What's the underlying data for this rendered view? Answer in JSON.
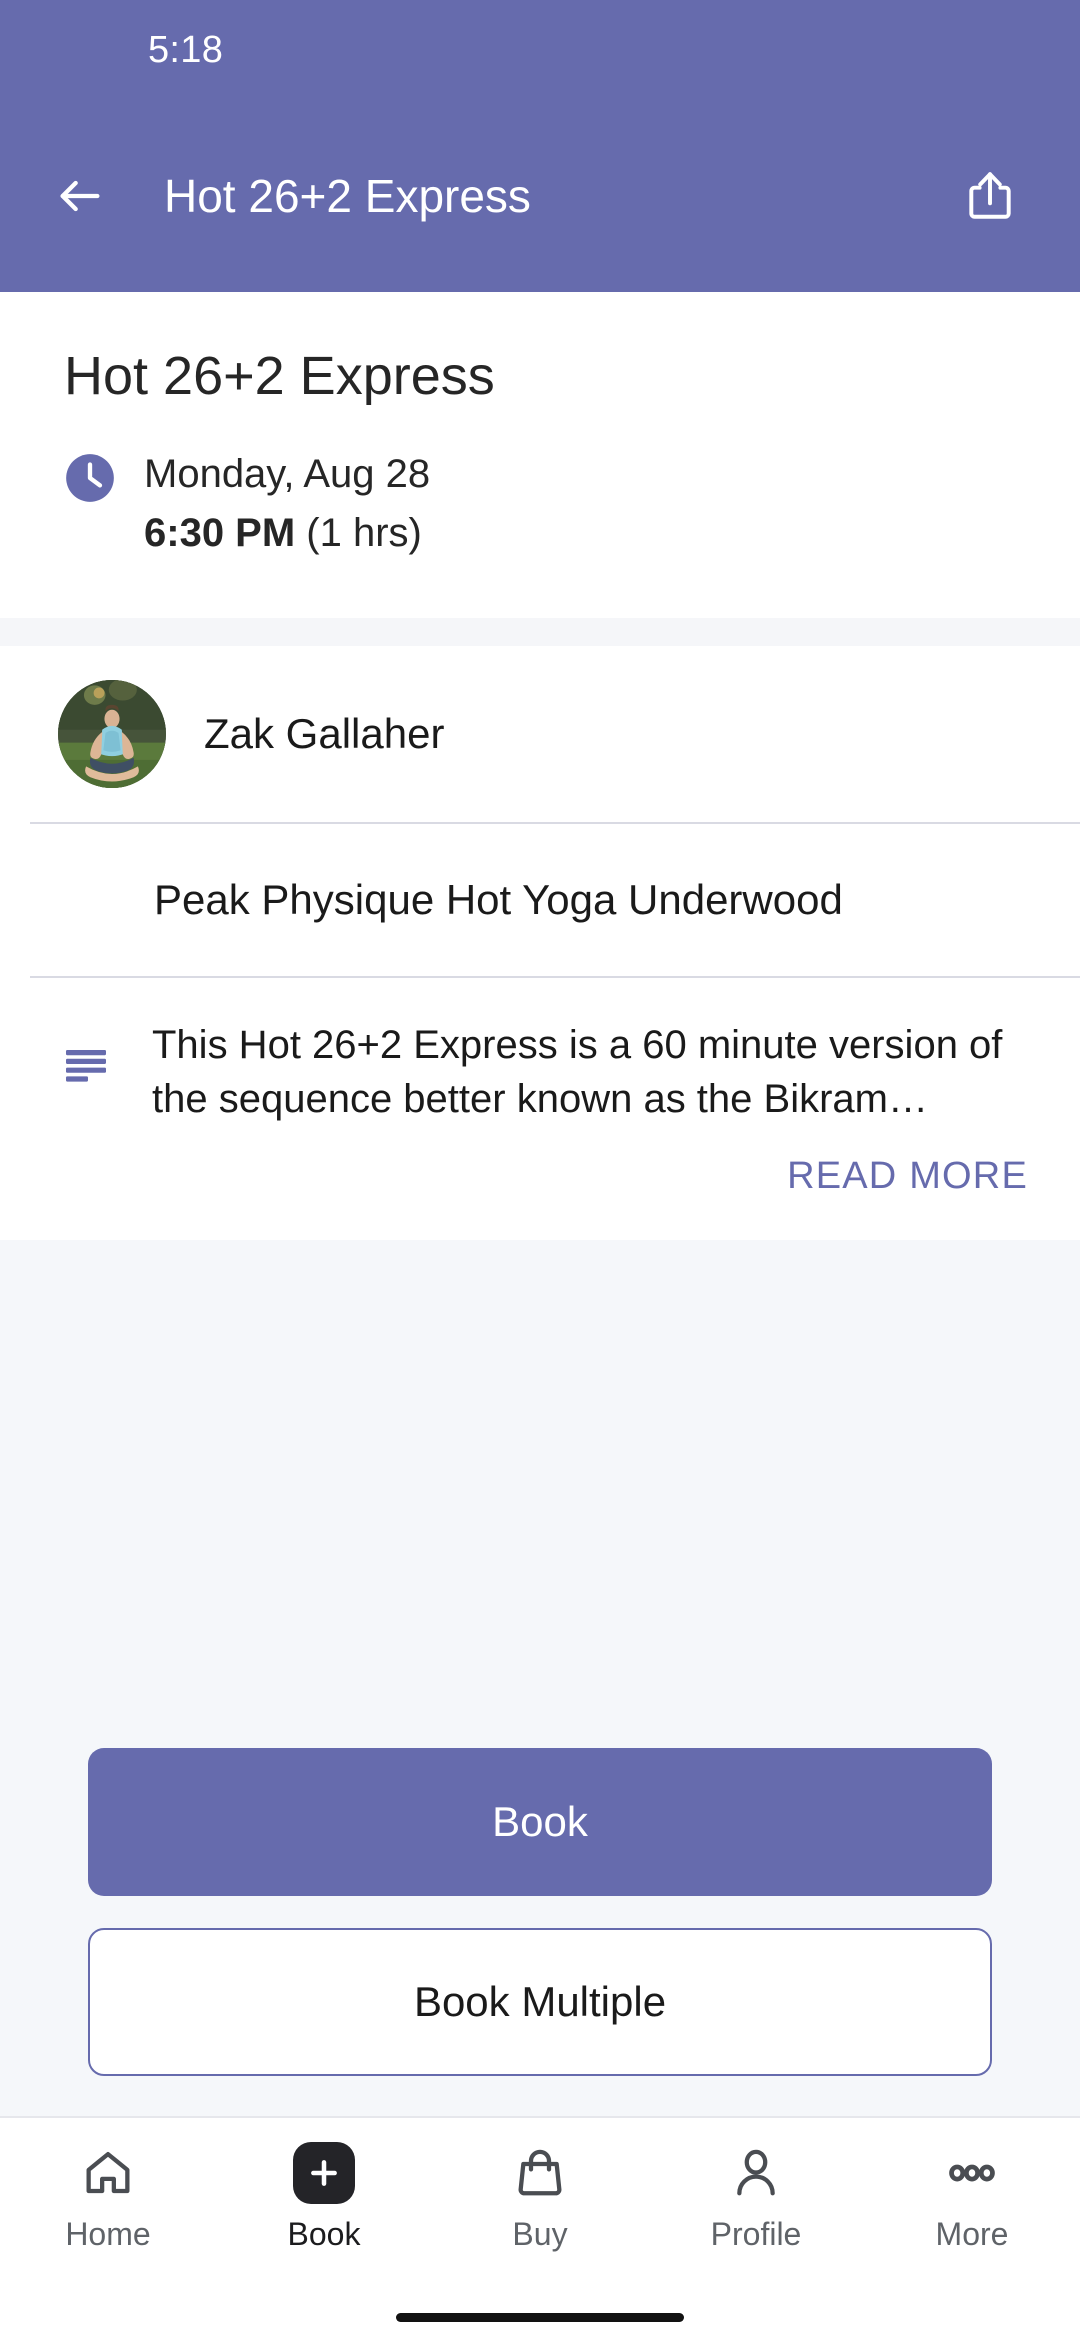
{
  "status_bar": {
    "time": "5:18"
  },
  "app_bar": {
    "title": "Hot 26+2 Express",
    "back_icon": "arrow-left-icon",
    "share_icon": "share-icon",
    "background_color": "#666bad"
  },
  "event": {
    "title": "Hot 26+2 Express",
    "clock_icon": "clock-icon",
    "date": "Monday, Aug 28",
    "time": "6:30 PM",
    "duration": "(1 hrs)"
  },
  "instructor": {
    "name": "Zak Gallaher",
    "avatar_icon": "avatar"
  },
  "location": {
    "name": "Peak Physique Hot Yoga Underwood"
  },
  "description": {
    "icon": "description-lines-icon",
    "text": "This Hot 26+2 Express is a 60 minute version of the sequence better known as the Bikram…",
    "read_more_label": "READ MORE",
    "link_color": "#666bad"
  },
  "actions": {
    "primary_label": "Book",
    "secondary_label": "Book Multiple"
  },
  "bottom_nav": {
    "items": [
      {
        "label": "Home",
        "icon": "home-icon",
        "active": false
      },
      {
        "label": "Book",
        "icon": "plus-icon",
        "active": true
      },
      {
        "label": "Buy",
        "icon": "bag-icon",
        "active": false
      },
      {
        "label": "Profile",
        "icon": "person-icon",
        "active": false
      },
      {
        "label": "More",
        "icon": "ellipsis-icon",
        "active": false
      }
    ]
  }
}
